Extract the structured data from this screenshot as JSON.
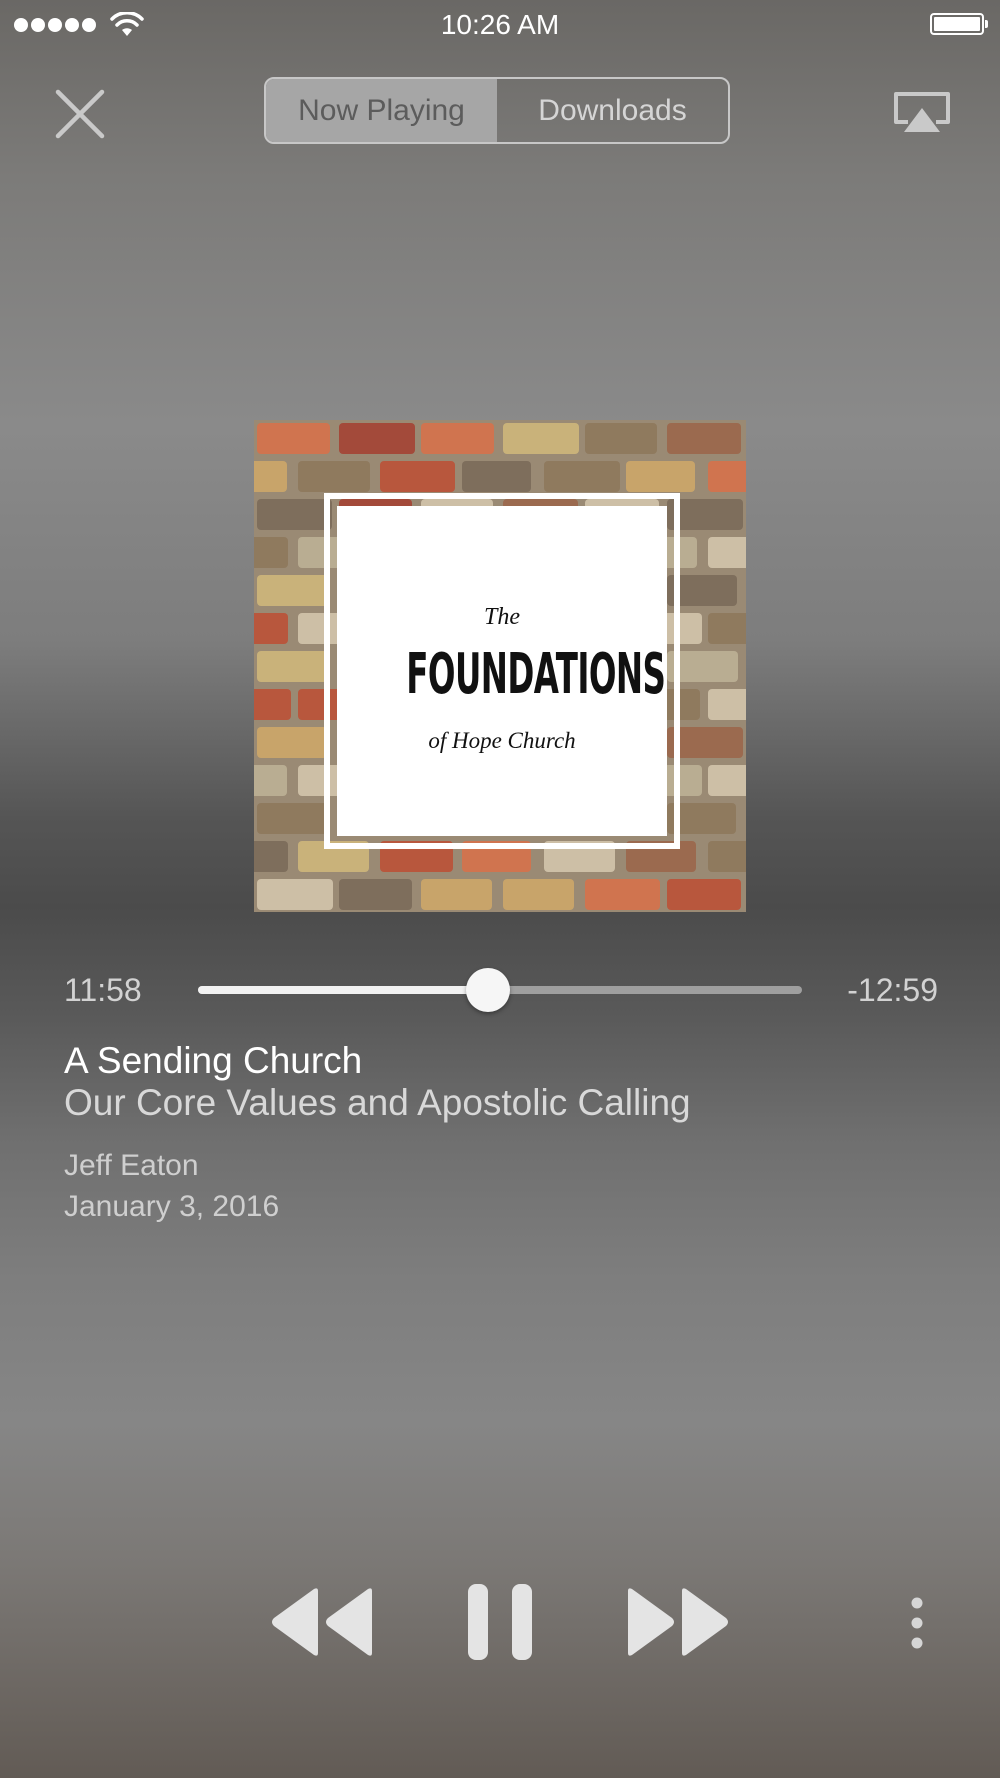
{
  "status_bar": {
    "time": "10:26 AM"
  },
  "header": {
    "tabs": [
      {
        "label": "Now Playing",
        "active": true
      },
      {
        "label": "Downloads",
        "active": false
      }
    ]
  },
  "artwork": {
    "line1": "The",
    "line2": "FOUNDATIONS",
    "line3": "of Hope Church"
  },
  "progress": {
    "elapsed": "11:58",
    "remaining": "-12:59",
    "fraction": 0.48
  },
  "track": {
    "title": "A Sending Church",
    "subtitle": "Our Core Values and Apostolic Calling",
    "speaker": "Jeff Eaton",
    "date": "January 3, 2016"
  },
  "icons": {
    "close": "close-icon",
    "airplay": "airplay-icon",
    "rewind": "rewind-icon",
    "pause": "pause-icon",
    "forward": "fast-forward-icon",
    "more": "more-vertical-icon"
  },
  "colors": {
    "control": "#e8e8e8",
    "segment_active_bg": "#a6a6a6"
  }
}
